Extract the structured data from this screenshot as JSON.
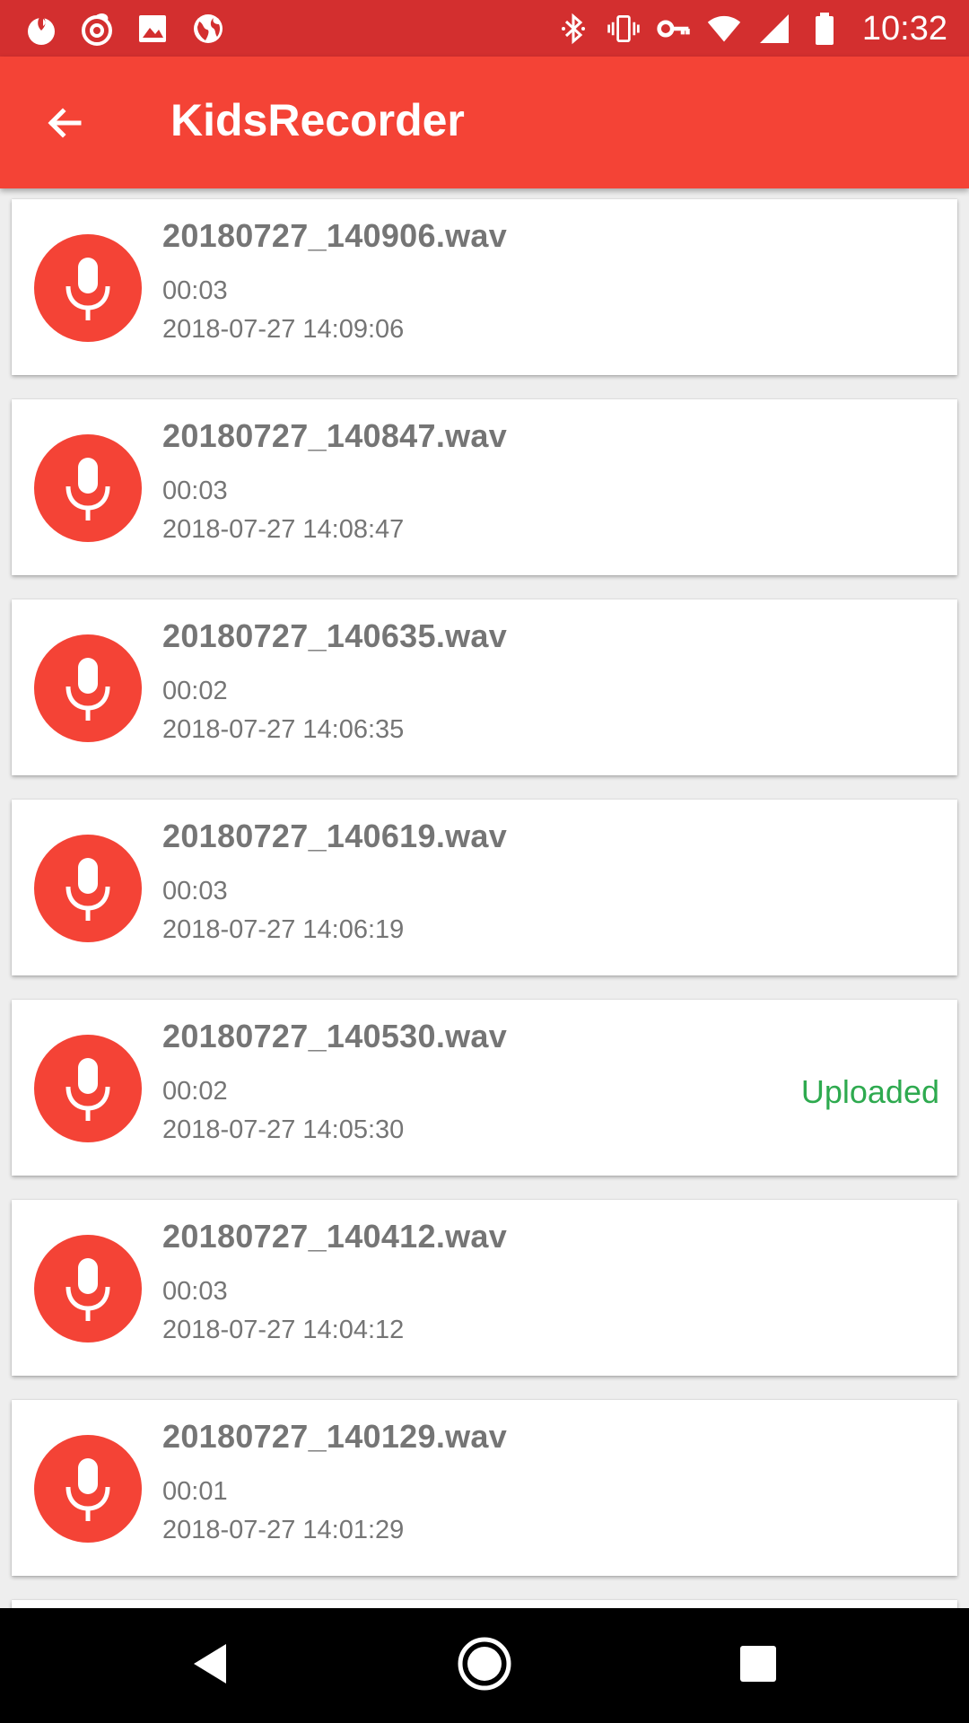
{
  "status_bar": {
    "time": "10:32",
    "left_icons": [
      "app-flame-icon",
      "app-swirl-icon",
      "image-icon",
      "globe-icon"
    ],
    "right_icons": [
      "bluetooth-icon",
      "vibrate-icon",
      "vpn-key-icon",
      "wifi-icon",
      "signal-icon",
      "battery-icon"
    ]
  },
  "app_bar": {
    "title": "KidsRecorder",
    "back_icon": "arrow-back-icon"
  },
  "colors": {
    "status_bar": "#d32f2f",
    "app_bar": "#f44336",
    "mic_circle": "#f44336",
    "uploaded": "#2eaa4f",
    "text_secondary": "#757575"
  },
  "recordings": [
    {
      "name": "20180727_140906.wav",
      "duration": "00:03",
      "date": "2018-07-27 14:09:06",
      "status": ""
    },
    {
      "name": "20180727_140847.wav",
      "duration": "00:03",
      "date": "2018-07-27 14:08:47",
      "status": ""
    },
    {
      "name": "20180727_140635.wav",
      "duration": "00:02",
      "date": "2018-07-27 14:06:35",
      "status": ""
    },
    {
      "name": "20180727_140619.wav",
      "duration": "00:03",
      "date": "2018-07-27 14:06:19",
      "status": ""
    },
    {
      "name": "20180727_140530.wav",
      "duration": "00:02",
      "date": "2018-07-27 14:05:30",
      "status": "Uploaded"
    },
    {
      "name": "20180727_140412.wav",
      "duration": "00:03",
      "date": "2018-07-27 14:04:12",
      "status": ""
    },
    {
      "name": "20180727_140129.wav",
      "duration": "00:01",
      "date": "2018-07-27 14:01:29",
      "status": ""
    }
  ],
  "nav_bar": {
    "buttons": [
      "back-triangle-icon",
      "home-circle-icon",
      "recents-square-icon"
    ]
  }
}
